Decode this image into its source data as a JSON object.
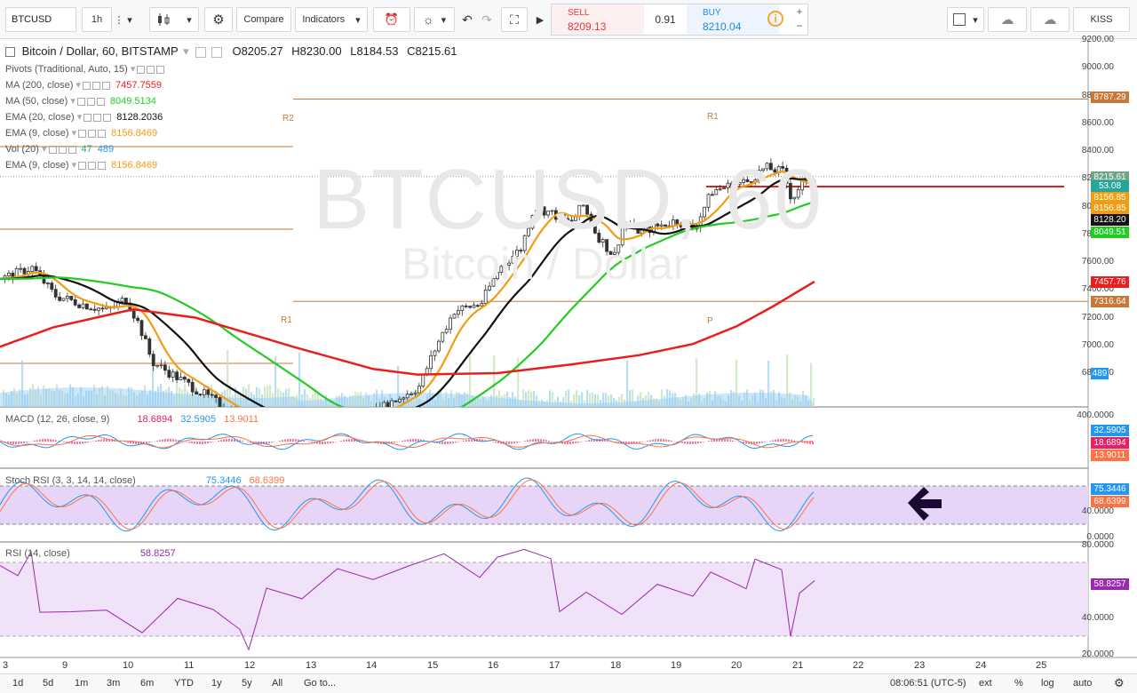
{
  "toolbar": {
    "symbol": "BTCUSD",
    "interval": "1h",
    "compare_label": "Compare",
    "indicators_label": "Indicators",
    "kiss_label": "KISS",
    "ticket": {
      "sell_label": "SELL",
      "sell_price": "8209.13",
      "spread": "0.91",
      "buy_label": "BUY",
      "buy_price": "8210.04",
      "plus": "+",
      "minus": "−"
    }
  },
  "main_legend": {
    "title": "Bitcoin / Dollar, 60, BITSTAMP",
    "open": "O8205.27",
    "high": "H8230.00",
    "low": "L8184.53",
    "close": "C8215.61"
  },
  "studies": [
    {
      "name": "Pivots (Traditional, Auto, 15)",
      "values": []
    },
    {
      "name": "MA (200, close)",
      "values": [
        {
          "v": "7457.7559",
          "color": "#e91e1e"
        }
      ]
    },
    {
      "name": "MA (50, close)",
      "values": [
        {
          "v": "8049.5134",
          "color": "#22cc22"
        }
      ]
    },
    {
      "name": "EMA (20, close)",
      "values": [
        {
          "v": "8128.2036",
          "color": "#111111"
        }
      ]
    },
    {
      "name": "EMA (9, close)",
      "values": [
        {
          "v": "8156.8469",
          "color": "#f39c12"
        }
      ]
    },
    {
      "name": "Vol (20)",
      "values": [
        {
          "v": "47",
          "color": "#26a69a"
        },
        {
          "v": "489",
          "color": "#2196f3"
        }
      ]
    },
    {
      "name": "EMA (9, close)",
      "values": [
        {
          "v": "8156.8469",
          "color": "#f39c12"
        }
      ]
    }
  ],
  "watermark": {
    "symbol": "BTCUSD, 60",
    "name": "Bitcoin / Dollar"
  },
  "pivots": {
    "r2": "R2",
    "r1_left": "R1",
    "r1_right": "R1",
    "p": "P"
  },
  "price_axis": [
    "9200.00",
    "9000.00",
    "8800.00",
    "8600.00",
    "8400.00",
    "8200.00",
    "8000.00",
    "7800.00",
    "7600.00",
    "7400.00",
    "7200.00",
    "7000.00",
    "6800.00"
  ],
  "price_tags": [
    {
      "v": "8787.29",
      "price": 8787.29,
      "bg": "#c8793a"
    },
    {
      "v": "8215.61",
      "price": 8215.61,
      "bg": "#6aa786"
    },
    {
      "v": "53.08",
      "price": 8150,
      "bg": "#26a69a"
    },
    {
      "v": "8156.85",
      "price": 8070,
      "bg": "#f39c12"
    },
    {
      "v": "8156.85",
      "price": 7990,
      "bg": "#f39c12"
    },
    {
      "v": "8128.20",
      "price": 7905,
      "bg": "#111111"
    },
    {
      "v": "8049.51",
      "price": 7820,
      "bg": "#22cc22"
    },
    {
      "v": "7457.76",
      "price": 7457.76,
      "bg": "#e91e1e"
    },
    {
      "v": "7316.64",
      "price": 7316.64,
      "bg": "#c8793a"
    },
    {
      "v": "489",
      "price": 6800,
      "bg": "#2196f3"
    }
  ],
  "macd": {
    "label": "MACD (12, 26, close, 9)",
    "values": [
      {
        "v": "18.6894",
        "color": "#e91e63"
      },
      {
        "v": "32.5905",
        "color": "#2196f3"
      },
      {
        "v": "13.9011",
        "color": "#ff7043"
      }
    ],
    "axis_top": "400.0000",
    "tags": [
      {
        "v": "32.5905",
        "bg": "#2196f3"
      },
      {
        "v": "18.6894",
        "bg": "#e91e63"
      },
      {
        "v": "13.9011",
        "bg": "#ff7043"
      }
    ]
  },
  "stoch": {
    "label": "Stoch RSI (3, 3, 14, 14, close)",
    "values": [
      {
        "v": "75.3446",
        "color": "#2196f3"
      },
      {
        "v": "68.6399",
        "color": "#ff7043"
      }
    ],
    "axis": [
      "40.0000",
      "0.0000"
    ],
    "tags": [
      {
        "v": "75.3446",
        "bg": "#2196f3"
      },
      {
        "v": "68.6399",
        "bg": "#ff7043"
      }
    ]
  },
  "rsi": {
    "label": "RSI (14, close)",
    "values": [
      {
        "v": "58.8257",
        "color": "#9c27b0"
      }
    ],
    "axis": [
      "80.0000",
      "40.0000",
      "20.0000"
    ],
    "tag": {
      "v": "58.8257",
      "bg": "#9c27b0"
    }
  },
  "date_axis": [
    "3",
    "9",
    "10",
    "11",
    "12",
    "13",
    "14",
    "15",
    "16",
    "17",
    "18",
    "19",
    "20",
    "21",
    "22",
    "23",
    "24",
    "25"
  ],
  "bottom_bar": {
    "ranges": [
      "1d",
      "5d",
      "1m",
      "3m",
      "6m",
      "YTD",
      "1y",
      "5y",
      "All"
    ],
    "goto": "Go to...",
    "clock": "08:06:51 (UTC-5)",
    "ext": "ext",
    "percent": "%",
    "log": "log",
    "auto": "auto"
  },
  "colors": {
    "ma200": "#e91e1e",
    "ma50": "#22cc22",
    "ema20": "#111111",
    "ema9": "#f39c12",
    "pivot": "#c8793a",
    "resistance": "#e02020",
    "stoch_band": "#e6d5f7",
    "rsi_band": "#efe2f9"
  },
  "chart_data": {
    "type": "candlestick",
    "ylim": [
      6700,
      9300
    ],
    "pivot_levels": {
      "R2": 8787.29,
      "R1": 8640,
      "P": 7316.64
    },
    "resistance_level": 8290,
    "last_price": 8215.61
  }
}
